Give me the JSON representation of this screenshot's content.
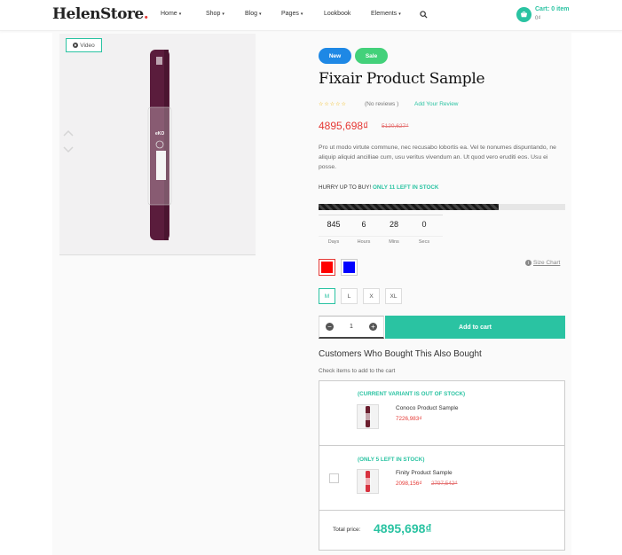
{
  "header": {
    "logo": "HelenStore",
    "logo_dot": ".",
    "nav": [
      {
        "label": "Home",
        "has_caret": true
      },
      {
        "label": "Shop",
        "has_caret": true
      },
      {
        "label": "Blog",
        "has_caret": true
      },
      {
        "label": "Pages",
        "has_caret": true
      },
      {
        "label": "Lookbook",
        "has_caret": false
      },
      {
        "label": "Elements",
        "has_caret": true
      }
    ],
    "search_icon": "search-icon",
    "cart_label": "Cart: 0 item",
    "cart_total": "0₫"
  },
  "gallery": {
    "video_label": "Video"
  },
  "product": {
    "badges": [
      "New",
      "Sale"
    ],
    "title": "Fixair Product Sample",
    "rating": 0,
    "reviews_label": "(No reviews )",
    "add_review": "Add Your Review",
    "price": "4895,698₫",
    "old_price": "5120,627₫",
    "description": "Pro ut modo virtute commune, nec recusabo lobortis ea. Vel te nonumes dispuntando, ne aliquip aliquid ancilliae cum, usu veritus vivendum an. Ut quod vero eruditi eos. Usu ei posse.",
    "hurry_text": "HURRY UP TO BUY!",
    "stock_text": "ONLY 11 LEFT IN STOCK",
    "stock_fraction": 0.73,
    "countdown": [
      {
        "value": "845",
        "label": "Days"
      },
      {
        "value": "6",
        "label": "Hours"
      },
      {
        "value": "28",
        "label": "Mins"
      },
      {
        "value": "0",
        "label": "Secs"
      }
    ],
    "colors": [
      {
        "name": "red",
        "hex": "#ff0000",
        "selected": true
      },
      {
        "name": "blue",
        "hex": "#0000ff",
        "selected": false
      }
    ],
    "size_chart": "Size Chart",
    "sizes": [
      {
        "label": "M",
        "selected": true
      },
      {
        "label": "L",
        "selected": false
      },
      {
        "label": "X",
        "selected": false
      },
      {
        "label": "XL",
        "selected": false
      }
    ],
    "quantity": "1",
    "add_to_cart": "Add to cart"
  },
  "fbt": {
    "title": "Customers Who Bought This Also Bought",
    "subtitle": "Check items to add to the cart",
    "items": [
      {
        "status": "(CURRENT VARIANT IS OUT OF STOCK)",
        "name": "Conoco Product Sample",
        "price": "7226,983₫",
        "old_price": ""
      },
      {
        "status": "(ONLY 5 LEFT IN STOCK)",
        "name": "Finity Product Sample",
        "price": "2098,156₫",
        "old_price": "2797,542₫"
      }
    ],
    "total_label": "Total price:",
    "total_value": "4895,698₫"
  },
  "colors": {
    "accent": "#2ac3a2",
    "sale": "#e53935",
    "badge_new": "#1e88e5",
    "badge_sale": "#43d17a"
  }
}
